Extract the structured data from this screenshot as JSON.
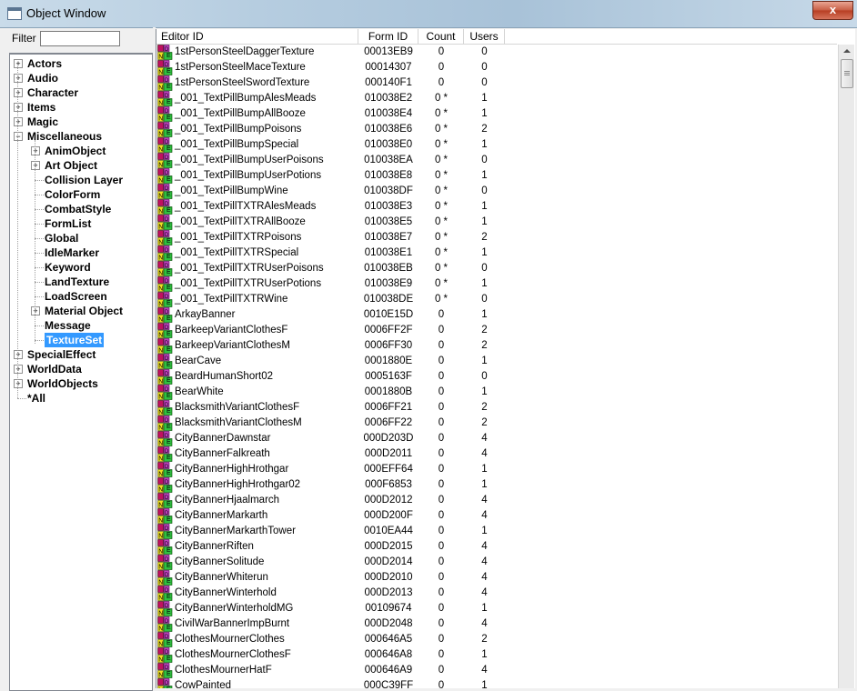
{
  "window": {
    "title": "Object Window",
    "close_label": "x"
  },
  "filter": {
    "label": "Filter",
    "value": ""
  },
  "tree": [
    {
      "label": "Actors",
      "level": 0,
      "expander": "+"
    },
    {
      "label": "Audio",
      "level": 0,
      "expander": "+"
    },
    {
      "label": "Character",
      "level": 0,
      "expander": "+"
    },
    {
      "label": "Items",
      "level": 0,
      "expander": "+"
    },
    {
      "label": "Magic",
      "level": 0,
      "expander": "+"
    },
    {
      "label": "Miscellaneous",
      "level": 0,
      "expander": "-"
    },
    {
      "label": "AnimObject",
      "level": 1,
      "expander": "+"
    },
    {
      "label": "Art Object",
      "level": 1,
      "expander": "+"
    },
    {
      "label": "Collision Layer",
      "level": 1,
      "expander": ""
    },
    {
      "label": "ColorForm",
      "level": 1,
      "expander": ""
    },
    {
      "label": "CombatStyle",
      "level": 1,
      "expander": ""
    },
    {
      "label": "FormList",
      "level": 1,
      "expander": ""
    },
    {
      "label": "Global",
      "level": 1,
      "expander": ""
    },
    {
      "label": "IdleMarker",
      "level": 1,
      "expander": ""
    },
    {
      "label": "Keyword",
      "level": 1,
      "expander": ""
    },
    {
      "label": "LandTexture",
      "level": 1,
      "expander": ""
    },
    {
      "label": "LoadScreen",
      "level": 1,
      "expander": ""
    },
    {
      "label": "Material Object",
      "level": 1,
      "expander": "+"
    },
    {
      "label": "Message",
      "level": 1,
      "expander": ""
    },
    {
      "label": "TextureSet",
      "level": 1,
      "expander": "",
      "selected": true
    },
    {
      "label": "SpecialEffect",
      "level": 0,
      "expander": "+"
    },
    {
      "label": "WorldData",
      "level": 0,
      "expander": "+"
    },
    {
      "label": "WorldObjects",
      "level": 0,
      "expander": "+"
    },
    {
      "label": "*All",
      "level": 0,
      "expander": ""
    }
  ],
  "columns": [
    "Editor ID",
    "Form ID",
    "Count",
    "Users"
  ],
  "rows": [
    [
      "1stPersonSteelDaggerTexture",
      "00013EB9",
      "0",
      "0"
    ],
    [
      "1stPersonSteelMaceTexture",
      "00014307",
      "0",
      "0"
    ],
    [
      "1stPersonSteelSwordTexture",
      "000140F1",
      "0",
      "0"
    ],
    [
      "_001_TextPillBumpAlesMeads",
      "010038E2",
      "0 *",
      "1"
    ],
    [
      "_001_TextPillBumpAllBooze",
      "010038E4",
      "0 *",
      "1"
    ],
    [
      "_001_TextPillBumpPoisons",
      "010038E6",
      "0 *",
      "2"
    ],
    [
      "_001_TextPillBumpSpecial",
      "010038E0",
      "0 *",
      "1"
    ],
    [
      "_001_TextPillBumpUserPoisons",
      "010038EA",
      "0 *",
      "0"
    ],
    [
      "_001_TextPillBumpUserPotions",
      "010038E8",
      "0 *",
      "1"
    ],
    [
      "_001_TextPillBumpWine",
      "010038DF",
      "0 *",
      "0"
    ],
    [
      "_001_TextPillTXTRAlesMeads",
      "010038E3",
      "0 *",
      "1"
    ],
    [
      "_001_TextPillTXTRAllBooze",
      "010038E5",
      "0 *",
      "1"
    ],
    [
      "_001_TextPillTXTRPoisons",
      "010038E7",
      "0 *",
      "2"
    ],
    [
      "_001_TextPillTXTRSpecial",
      "010038E1",
      "0 *",
      "1"
    ],
    [
      "_001_TextPillTXTRUserPoisons",
      "010038EB",
      "0 *",
      "0"
    ],
    [
      "_001_TextPillTXTRUserPotions",
      "010038E9",
      "0 *",
      "1"
    ],
    [
      "_001_TextPillTXTRWine",
      "010038DE",
      "0 *",
      "0"
    ],
    [
      "ArkayBanner",
      "0010E15D",
      "0",
      "1"
    ],
    [
      "BarkeepVariantClothesF",
      "0006FF2F",
      "0",
      "2"
    ],
    [
      "BarkeepVariantClothesM",
      "0006FF30",
      "0",
      "2"
    ],
    [
      "BearCave",
      "0001880E",
      "0",
      "1"
    ],
    [
      "BeardHumanShort02",
      "0005163F",
      "0",
      "0"
    ],
    [
      "BearWhite",
      "0001880B",
      "0",
      "1"
    ],
    [
      "BlacksmithVariantClothesF",
      "0006FF21",
      "0",
      "2"
    ],
    [
      "BlacksmithVariantClothesM",
      "0006FF22",
      "0",
      "2"
    ],
    [
      "CityBannerDawnstar",
      "000D203D",
      "0",
      "4"
    ],
    [
      "CityBannerFalkreath",
      "000D2011",
      "0",
      "4"
    ],
    [
      "CityBannerHighHrothgar",
      "000EFF64",
      "0",
      "1"
    ],
    [
      "CityBannerHighHrothgar02",
      "000F6853",
      "0",
      "1"
    ],
    [
      "CityBannerHjaalmarch",
      "000D2012",
      "0",
      "4"
    ],
    [
      "CityBannerMarkarth",
      "000D200F",
      "0",
      "4"
    ],
    [
      "CityBannerMarkarthTower",
      "0010EA44",
      "0",
      "1"
    ],
    [
      "CityBannerRiften",
      "000D2015",
      "0",
      "4"
    ],
    [
      "CityBannerSolitude",
      "000D2014",
      "0",
      "4"
    ],
    [
      "CityBannerWhiterun",
      "000D2010",
      "0",
      "4"
    ],
    [
      "CityBannerWinterhold",
      "000D2013",
      "0",
      "4"
    ],
    [
      "CityBannerWinterholdMG",
      "00109674",
      "0",
      "1"
    ],
    [
      "CivilWarBannerImpBurnt",
      "000D2048",
      "0",
      "4"
    ],
    [
      "ClothesMournerClothes",
      "000646A5",
      "0",
      "2"
    ],
    [
      "ClothesMournerClothesF",
      "000646A8",
      "0",
      "1"
    ],
    [
      "ClothesMournerHatF",
      "000646A9",
      "0",
      "4"
    ],
    [
      "CowPainted",
      "000C39FF",
      "0",
      "1"
    ]
  ]
}
